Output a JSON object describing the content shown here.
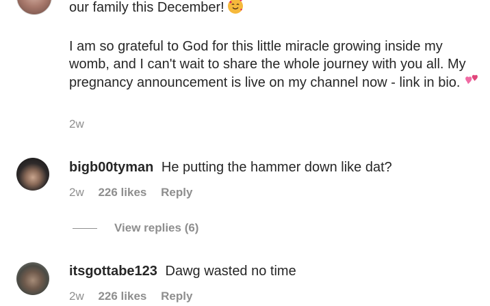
{
  "post": {
    "caption_line1": "our family this December!",
    "caption_body_p1": "I am so grateful to God for this little miracle growing inside my womb, and I can't wait to share the whole journey with you all. My pregnancy announcement is live on my channel now - link in bio.",
    "time": "2w"
  },
  "comments": [
    {
      "username": "bigb00tyman",
      "text": "He putting the hammer down like dat?",
      "time": "2w",
      "likes": "226 likes",
      "reply_label": "Reply",
      "view_replies": "View replies (6)"
    },
    {
      "username": "itsgottabe123",
      "text": "Dawg wasted no time",
      "time": "2w",
      "likes": "226 likes",
      "reply_label": "Reply"
    }
  ],
  "icons": {
    "emoji_1": "smiling-face-with-hearts-icon",
    "emoji_2": "two-hearts-icon"
  }
}
